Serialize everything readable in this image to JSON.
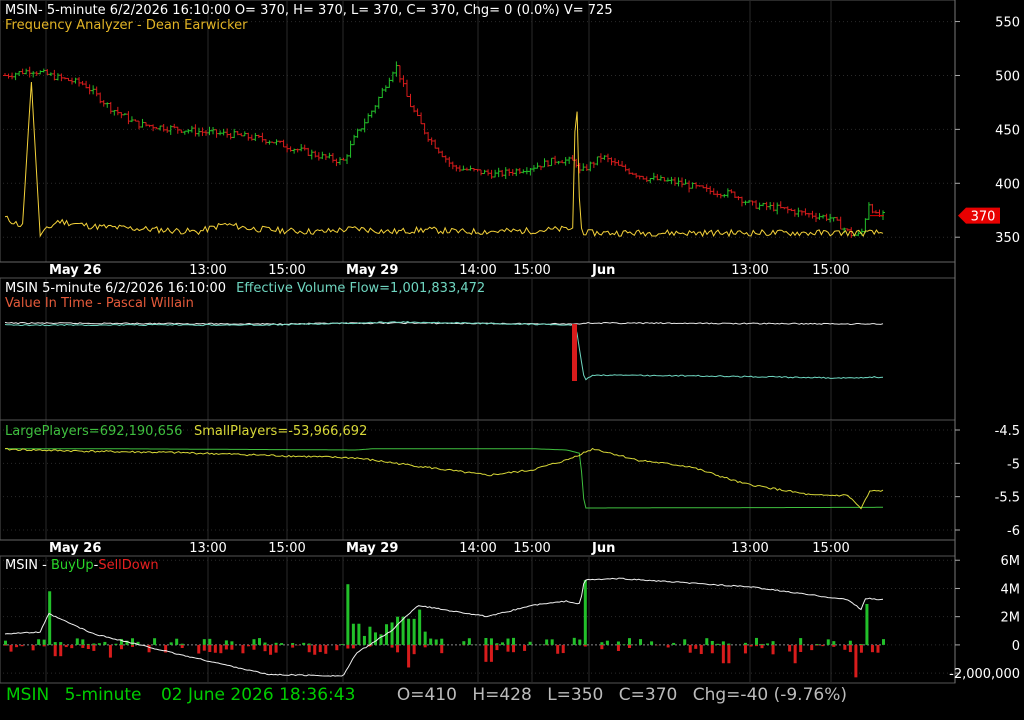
{
  "colors": {
    "background": "#000000",
    "grid": "#2a2a2a",
    "up": "#22c02a",
    "down": "#d81c1c",
    "oscillator": "#f4d23a",
    "flow_white": "#e8e8e8",
    "flow_cyan": "#6fd6c0",
    "large_players": "#3fbf3f",
    "small_players": "#d8d838",
    "white_line": "#f0f0f0",
    "price_tag": "#e80000",
    "status_green": "#00cc00",
    "status_gray": "#bbbbbb"
  },
  "panel1": {
    "title": "MSIN- 5-minute 6/2/2026 16:10:00 O= 370, H= 370, L= 370, C= 370, Chg= 0 (0.0%) V= 725",
    "study": "Frequency Analyzer - Dean Earwicker",
    "price_tag": "370"
  },
  "panel2": {
    "title": "MSIN 5-minute  6/2/2026 16:10:00",
    "flow_label": "Effective Volume Flow=1,001,833,472",
    "study_name": "Value In Time",
    "study_sep": " - ",
    "study_author": "Pascal Willain"
  },
  "panel3": {
    "large_label": "LargePlayers=692,190,656",
    "small_label": "SmallPlayers=-53,966,692"
  },
  "panel4": {
    "prefix": "MSIN - ",
    "buy_label": "BuyUp",
    "dash": "-",
    "sell_label": "SellDown"
  },
  "status": {
    "symbol": "MSIN",
    "interval": "5-minute",
    "datetime": "02 June 2026 18:36:43",
    "open": "O=410",
    "high": "H=428",
    "low": "L=350",
    "close": "C=370",
    "change": "Chg=-40 (-9.76%)"
  },
  "chart_data": [
    {
      "type": "candlestick",
      "title": "MSIN- 5-minute 6/2/2026 16:10:00 O= 370, H= 370, L= 370, C= 370, Chg= 0 (0.0%) V= 725",
      "yticks": [
        550,
        500,
        450,
        400,
        350
      ],
      "ylim": [
        327,
        570
      ],
      "x_tick_labels": [
        "May 26",
        "13:00",
        "15:00",
        "May 29",
        "14:00",
        "15:00",
        "Jun",
        "13:00",
        "15:00"
      ],
      "last_price": 370,
      "grid": true,
      "path": [
        [
          0,
          500
        ],
        [
          0.03,
          505
        ],
        [
          0.06,
          498
        ],
        [
          0.09,
          492
        ],
        [
          0.12,
          470
        ],
        [
          0.15,
          455
        ],
        [
          0.18,
          452
        ],
        [
          0.22,
          448
        ],
        [
          0.26,
          445
        ],
        [
          0.3,
          440
        ],
        [
          0.33,
          432
        ],
        [
          0.36,
          425
        ],
        [
          0.385,
          420
        ],
        [
          0.4,
          445
        ],
        [
          0.42,
          470
        ],
        [
          0.445,
          510
        ],
        [
          0.46,
          475
        ],
        [
          0.48,
          445
        ],
        [
          0.51,
          415
        ],
        [
          0.53,
          412
        ],
        [
          0.56,
          408
        ],
        [
          0.6,
          415
        ],
        [
          0.63,
          422
        ],
        [
          0.65,
          420
        ],
        [
          0.655,
          410
        ],
        [
          0.68,
          425
        ],
        [
          0.7,
          415
        ],
        [
          0.73,
          405
        ],
        [
          0.77,
          400
        ],
        [
          0.8,
          393
        ],
        [
          0.83,
          390
        ],
        [
          0.85,
          380
        ],
        [
          0.88,
          377
        ],
        [
          0.91,
          372
        ],
        [
          0.94,
          368
        ],
        [
          0.965,
          352
        ],
        [
          0.975,
          352
        ],
        [
          0.985,
          385
        ],
        [
          0.99,
          370
        ],
        [
          1.0,
          370
        ]
      ],
      "oscillator_path": [
        [
          0,
          368
        ],
        [
          0.02,
          360
        ],
        [
          0.03,
          495
        ],
        [
          0.04,
          352
        ],
        [
          0.06,
          365
        ],
        [
          0.1,
          360
        ],
        [
          0.15,
          358
        ],
        [
          0.22,
          355
        ],
        [
          0.25,
          362
        ],
        [
          0.28,
          358
        ],
        [
          0.32,
          356
        ],
        [
          0.36,
          355
        ],
        [
          0.4,
          358
        ],
        [
          0.44,
          355
        ],
        [
          0.48,
          357
        ],
        [
          0.52,
          355
        ],
        [
          0.6,
          356
        ],
        [
          0.648,
          358
        ],
        [
          0.65,
          518
        ],
        [
          0.655,
          360
        ],
        [
          0.66,
          354
        ],
        [
          0.7,
          354
        ],
        [
          0.8,
          354
        ],
        [
          0.9,
          354
        ],
        [
          0.97,
          354
        ],
        [
          1.0,
          354
        ]
      ]
    },
    {
      "type": "line",
      "title": "MSIN 5-minute  6/2/2026 16:10:00",
      "series": [
        {
          "name": "Effective Volume Flow",
          "path": [
            [
              0,
              323
            ],
            [
              0.3,
              324
            ],
            [
              0.45,
              323
            ],
            [
              0.65,
              324
            ],
            [
              0.66,
              323
            ],
            [
              1.0,
              324
            ]
          ]
        },
        {
          "name": "Value In Time",
          "path": [
            [
              0,
              325
            ],
            [
              0.3,
              325
            ],
            [
              0.45,
              322
            ],
            [
              0.65,
              325
            ],
            [
              0.66,
              380
            ],
            [
              0.67,
              375
            ],
            [
              0.8,
              376
            ],
            [
              0.95,
              378
            ],
            [
              1.0,
              377
            ]
          ]
        }
      ]
    },
    {
      "type": "line",
      "yticks": [
        -4.5,
        -5,
        -5.5,
        -6
      ],
      "ylim": [
        -6.15,
        -4.35
      ],
      "series": [
        {
          "name": "LargePlayers",
          "path": [
            [
              0,
              -4.78
            ],
            [
              0.1,
              -4.78
            ],
            [
              0.4,
              -4.8
            ],
            [
              0.42,
              -4.78
            ],
            [
              0.6,
              -4.78
            ],
            [
              0.64,
              -4.8
            ],
            [
              0.655,
              -4.85
            ],
            [
              0.66,
              -5.67
            ],
            [
              1.0,
              -5.66
            ]
          ]
        },
        {
          "name": "SmallPlayers",
          "path": [
            [
              0,
              -4.79
            ],
            [
              0.1,
              -4.82
            ],
            [
              0.2,
              -4.84
            ],
            [
              0.4,
              -4.92
            ],
            [
              0.55,
              -5.18
            ],
            [
              0.6,
              -5.1
            ],
            [
              0.64,
              -4.95
            ],
            [
              0.67,
              -4.78
            ],
            [
              0.72,
              -4.95
            ],
            [
              0.78,
              -5.05
            ],
            [
              0.84,
              -5.3
            ],
            [
              0.92,
              -5.48
            ],
            [
              0.96,
              -5.48
            ],
            [
              0.975,
              -5.68
            ],
            [
              0.985,
              -5.42
            ],
            [
              1.0,
              -5.41
            ]
          ]
        }
      ]
    },
    {
      "type": "bar",
      "yticks": [
        6000000,
        4000000,
        2000000,
        0,
        -2000000
      ],
      "ytick_labels": [
        "6M",
        "4M",
        "2M",
        "0",
        "-2,000,000"
      ],
      "ylim": [
        -2700000,
        6300000
      ],
      "series": [
        {
          "name": "BuyUp",
          "path": [
            [
              0,
              300000
            ],
            [
              0.04,
              400000
            ],
            [
              0.05,
              3800000
            ],
            [
              0.06,
              200000
            ],
            [
              0.1,
              100000
            ],
            [
              0.39,
              4300000
            ],
            [
              0.4,
              1500000
            ],
            [
              0.45,
              2000000
            ],
            [
              0.47,
              2500000
            ],
            [
              0.65,
              500000
            ],
            [
              0.66,
              4600000
            ],
            [
              0.98,
              2900000
            ]
          ]
        },
        {
          "name": "SellDown",
          "path": [
            [
              0.06,
              -800000
            ],
            [
              0.12,
              -900000
            ],
            [
              0.3,
              -700000
            ],
            [
              0.46,
              -1600000
            ],
            [
              0.55,
              -1200000
            ],
            [
              0.82,
              -1300000
            ],
            [
              0.9,
              -1300000
            ],
            [
              0.97,
              -2300000
            ]
          ]
        },
        {
          "name": "Net",
          "path": [
            [
              0,
              800000
            ],
            [
              0.04,
              900000
            ],
            [
              0.05,
              2200000
            ],
            [
              0.1,
              800000
            ],
            [
              0.2,
              -700000
            ],
            [
              0.3,
              -2100000
            ],
            [
              0.385,
              -2200000
            ],
            [
              0.4,
              -600000
            ],
            [
              0.44,
              1000000
            ],
            [
              0.47,
              2800000
            ],
            [
              0.55,
              2000000
            ],
            [
              0.6,
              2800000
            ],
            [
              0.64,
              3100000
            ],
            [
              0.655,
              2900000
            ],
            [
              0.66,
              4600000
            ],
            [
              0.7,
              4700000
            ],
            [
              0.85,
              4100000
            ],
            [
              0.96,
              3200000
            ],
            [
              0.975,
              2500000
            ],
            [
              0.98,
              3300000
            ],
            [
              1.0,
              3200000
            ]
          ]
        }
      ]
    }
  ]
}
